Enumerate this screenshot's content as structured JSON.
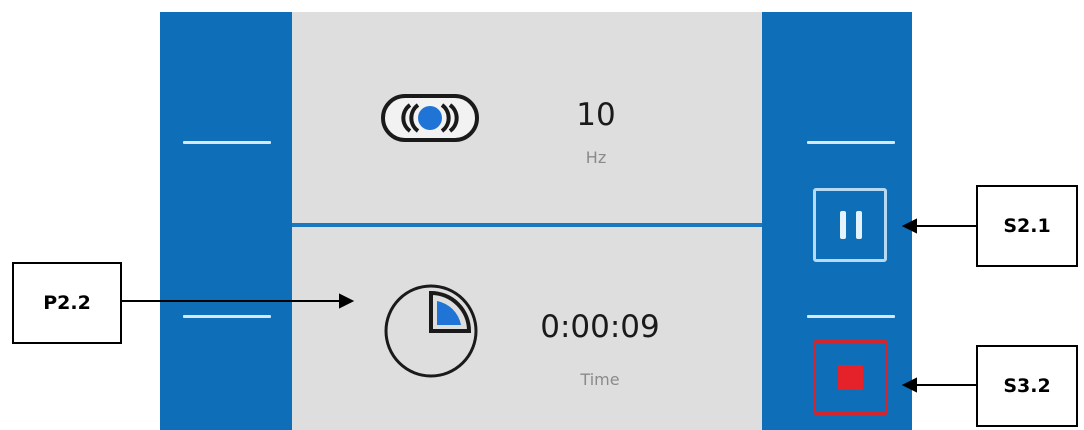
{
  "frequency": {
    "icon": "vibration-icon",
    "value": "10",
    "unit": "Hz"
  },
  "time": {
    "icon": "timer-icon",
    "value": "0:00:09",
    "unit": "Time"
  },
  "controls": {
    "pause_icon": "pause-icon",
    "stop_icon": "stop-icon"
  },
  "callouts": {
    "pause": "S2.1",
    "time_display": "P2.2",
    "stop": "S3.2"
  },
  "colors": {
    "panel_blue": "#0f6eb8",
    "screen_grey": "#dedede",
    "stop_red": "#e5222a",
    "accent_blue": "#1f74d6"
  }
}
